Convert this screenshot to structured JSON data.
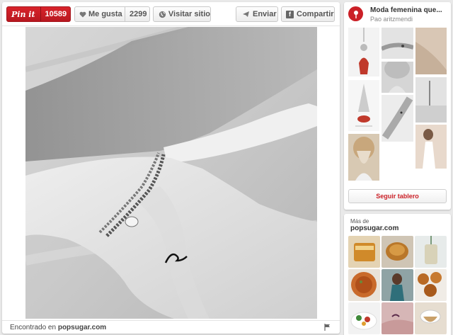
{
  "toolbar": {
    "pinit_label": "Pin it",
    "pin_count": "10589",
    "like_label": "Me gusta",
    "like_count": "2299",
    "visit_label": "Visitar sitio",
    "send_label": "Enviar",
    "share_label": "Compartir"
  },
  "pin": {
    "source_prefix": "Encontrado en",
    "source_domain": "popsugar.com"
  },
  "board": {
    "title": "Moda femenina que...",
    "owner": "Pao aritzmendi",
    "follow_label": "Seguir tablero"
  },
  "more_from": {
    "label": "Más de",
    "site": "popsugar.com"
  },
  "colors": {
    "brand_red": "#cb2027",
    "background": "#e9e9e9",
    "panel": "#ffffff"
  },
  "icons": [
    "heart-icon",
    "globe-icon",
    "send-icon",
    "facebook-icon",
    "flag-icon",
    "pushpin-icon"
  ]
}
